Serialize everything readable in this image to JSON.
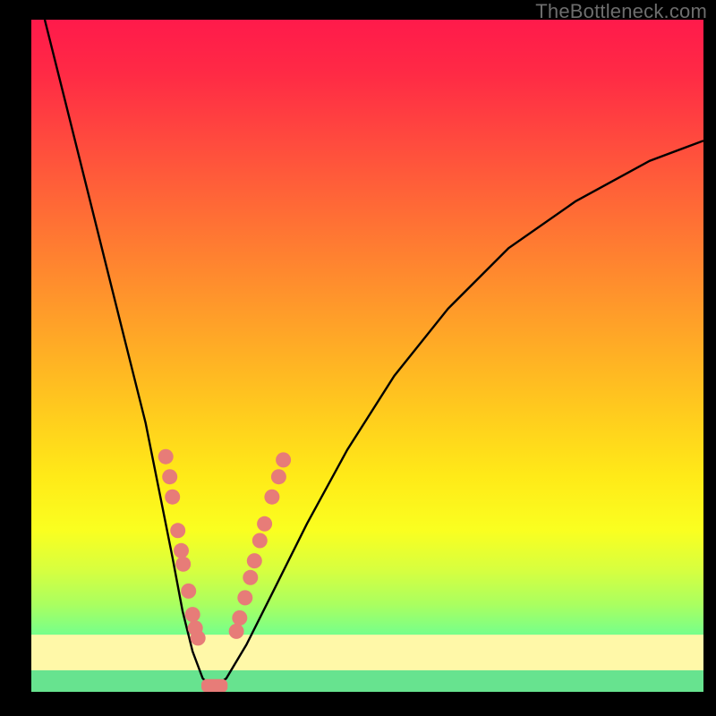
{
  "watermark": {
    "text": "TheBottleneck.com"
  },
  "colors": {
    "curve": "#000000",
    "marker_fill": "#e77c78",
    "marker_stroke": "#c15b57",
    "pale_band": "#fff8a8",
    "green_band": "#67e38f",
    "coral_bar": "#e77c78"
  },
  "chart_data": {
    "type": "line",
    "title": "",
    "xlabel": "",
    "ylabel": "",
    "xlim": [
      0,
      100
    ],
    "ylim": [
      0,
      100
    ],
    "grid": false,
    "annotations": [],
    "series": [
      {
        "name": "bottleneck-curve",
        "x": [
          2,
          5,
          8,
          11,
          14,
          17,
          19,
          21,
          22.5,
          24,
          25.5,
          27,
          29,
          32,
          36,
          41,
          47,
          54,
          62,
          71,
          81,
          92,
          100
        ],
        "y": [
          100,
          88,
          76,
          64,
          52,
          40,
          30,
          20,
          12,
          6,
          2,
          0.5,
          2,
          7,
          15,
          25,
          36,
          47,
          57,
          66,
          73,
          79,
          82
        ]
      }
    ],
    "markers_left": [
      {
        "x": 20.0,
        "y": 35.0
      },
      {
        "x": 20.6,
        "y": 32.0
      },
      {
        "x": 21.0,
        "y": 29.0
      },
      {
        "x": 21.8,
        "y": 24.0
      },
      {
        "x": 22.3,
        "y": 21.0
      },
      {
        "x": 22.6,
        "y": 19.0
      },
      {
        "x": 23.4,
        "y": 15.0
      },
      {
        "x": 24.0,
        "y": 11.5
      },
      {
        "x": 24.4,
        "y": 9.5
      },
      {
        "x": 24.8,
        "y": 8.0
      }
    ],
    "markers_right": [
      {
        "x": 30.5,
        "y": 9.0
      },
      {
        "x": 31.0,
        "y": 11.0
      },
      {
        "x": 31.8,
        "y": 14.0
      },
      {
        "x": 32.6,
        "y": 17.0
      },
      {
        "x": 33.2,
        "y": 19.5
      },
      {
        "x": 34.0,
        "y": 22.5
      },
      {
        "x": 34.7,
        "y": 25.0
      },
      {
        "x": 35.8,
        "y": 29.0
      },
      {
        "x": 36.8,
        "y": 32.0
      },
      {
        "x": 37.5,
        "y": 34.5
      }
    ],
    "bottom_bar": {
      "x0": 25.3,
      "x1": 29.2,
      "y": 0.9,
      "h": 2.0
    }
  }
}
